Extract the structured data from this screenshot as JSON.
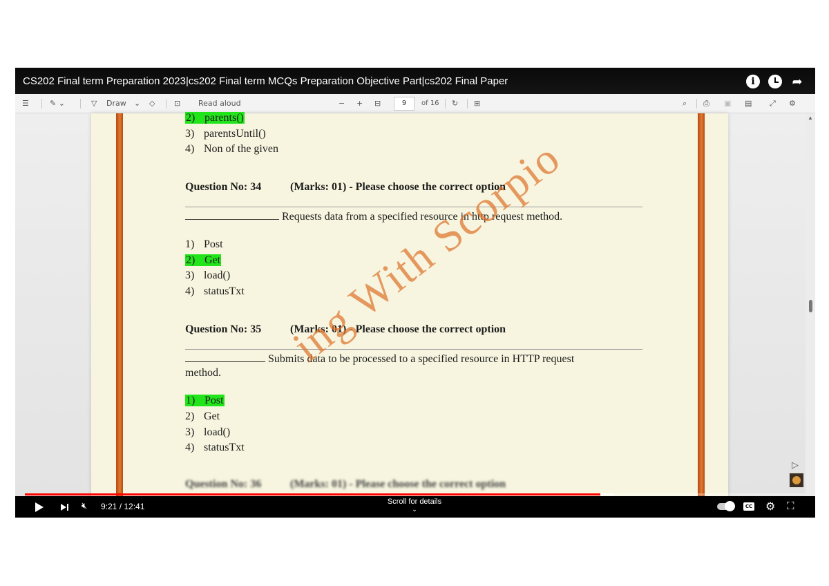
{
  "video": {
    "title": "CS202 Final term Preparation 2023|cs202 Final term MCQs Preparation Objective Part|cs202 Final Paper",
    "time": "9:21 / 12:41",
    "progress": 0.7375,
    "scroll_hint": "Scroll for details"
  },
  "pdf_toolbar": {
    "draw_label": "Draw",
    "read_aloud_label": "Read aloud",
    "page_current": "9",
    "page_total": "of 16",
    "zoom_out": "−",
    "zoom_in": "+"
  },
  "document": {
    "top_options": [
      {
        "num": "2)",
        "text": "parents()",
        "correct": true
      },
      {
        "num": "3)",
        "text": "parentsUntil()",
        "correct": false
      },
      {
        "num": "4)",
        "text": "Non of the given",
        "correct": false
      }
    ],
    "q34": {
      "heading": "Question No: 34",
      "marks": "(Marks: 01) - Please choose the correct option",
      "statement": "Requests data from a specified resource in http request method.",
      "options": [
        {
          "num": "1)",
          "text": "Post",
          "correct": false
        },
        {
          "num": "2)",
          "text": "Get",
          "correct": true
        },
        {
          "num": "3)",
          "text": "load()",
          "correct": false
        },
        {
          "num": "4)",
          "text": "statusTxt",
          "correct": false
        }
      ]
    },
    "q35": {
      "heading": "Question No: 35",
      "marks": "(Marks: 01) - Please choose the correct option",
      "statement": "Submits data to be processed to a specified resource in HTTP request",
      "statement_cont": "method.",
      "options": [
        {
          "num": "1)",
          "text": "Post",
          "correct": true
        },
        {
          "num": "2)",
          "text": "Get",
          "correct": false
        },
        {
          "num": "3)",
          "text": "load()",
          "correct": false
        },
        {
          "num": "4)",
          "text": "statusTxt",
          "correct": false
        }
      ]
    },
    "q36_blurred": {
      "heading": "Question No: 36",
      "marks": "(Marks: 01) - Please choose the correct option"
    },
    "watermark": "ing With Scorpio"
  },
  "colors": {
    "highlight": "#22e41b",
    "frame_bar": "#d2631f",
    "progress": "#ff0000",
    "paper": "#f7f5df"
  }
}
